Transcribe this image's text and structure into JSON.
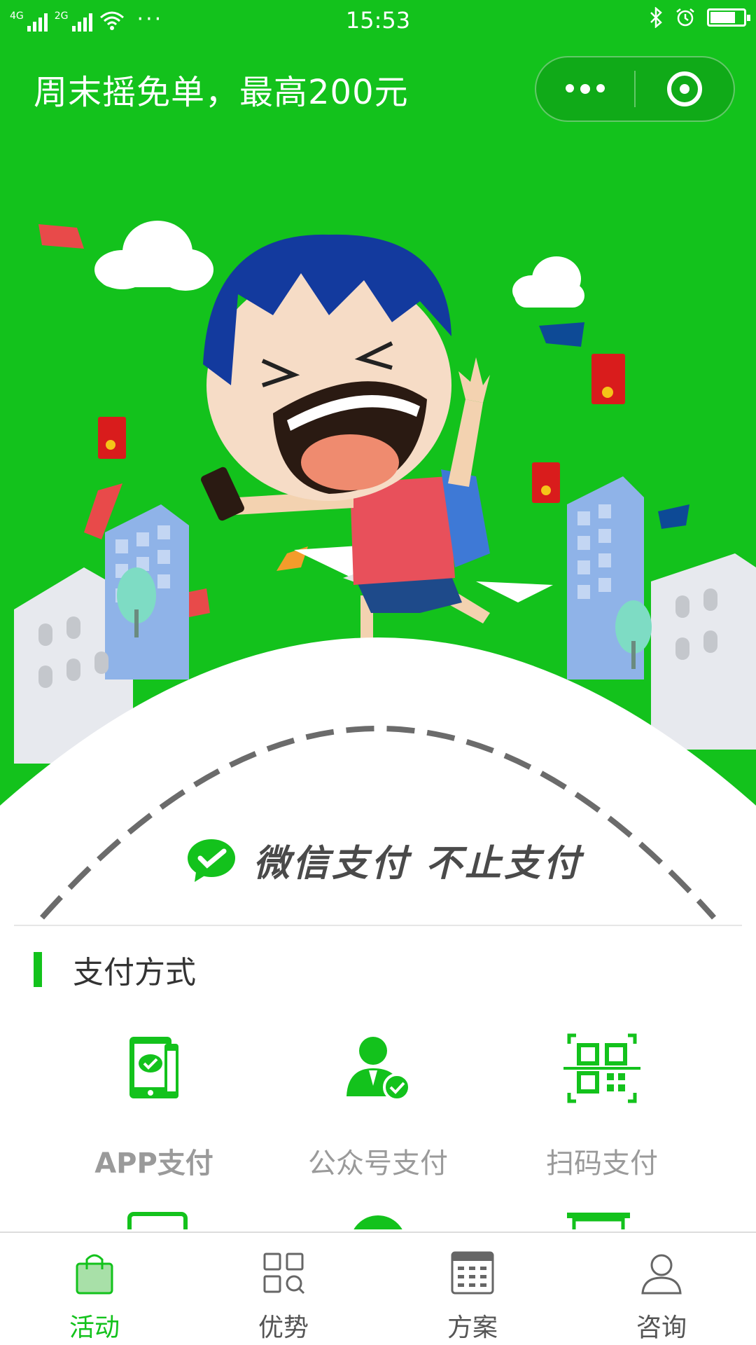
{
  "status_bar": {
    "net1": "4G",
    "net2": "2G",
    "dots": "···",
    "time": "15:53"
  },
  "nav": {
    "title": "周末摇免单，最高200元"
  },
  "banner": {
    "slogan": "微信支付 不止支付"
  },
  "section": {
    "title": "支付方式"
  },
  "payment_methods": [
    {
      "label": "APP支付",
      "icon": "phone-pay-icon"
    },
    {
      "label": "公众号支付",
      "icon": "official-account-pay-icon"
    },
    {
      "label": "扫码支付",
      "icon": "qr-scan-pay-icon"
    }
  ],
  "tabbar": {
    "items": [
      {
        "label": "活动",
        "icon": "shopping-bag-icon",
        "active": true
      },
      {
        "label": "优势",
        "icon": "grid-search-icon",
        "active": false
      },
      {
        "label": "方案",
        "icon": "calendar-table-icon",
        "active": false
      },
      {
        "label": "咨询",
        "icon": "user-icon",
        "active": false
      }
    ]
  },
  "colors": {
    "brand_green": "#13c21c",
    "text_gray": "#9a9a9a",
    "tab_inactive": "#555555"
  }
}
